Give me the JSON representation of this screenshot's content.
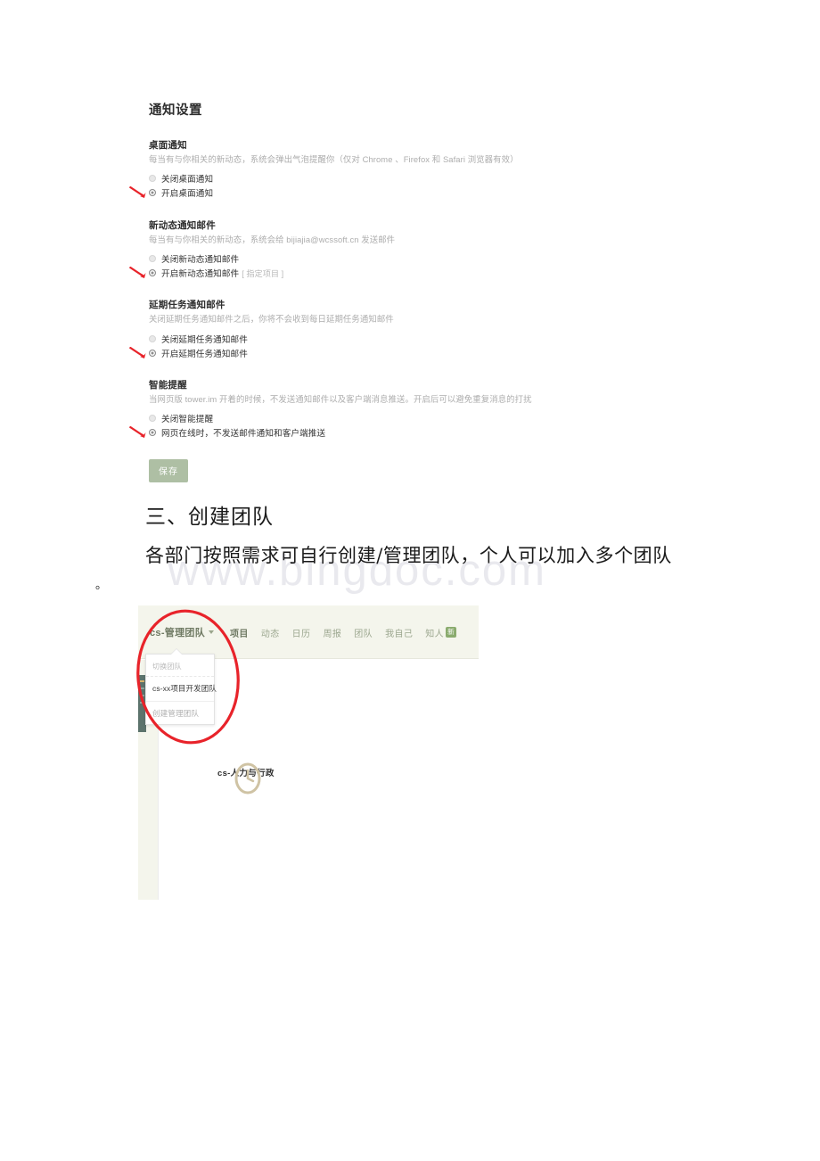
{
  "settings_panel": {
    "title": "通知设置",
    "blocks": [
      {
        "heading": "桌面通知",
        "description": "每当有与你相关的新动态，系统会弹出气泡提醒你（仅对 Chrome 、Firefox 和 Safari 浏览器有效）",
        "options": [
          {
            "label": "关闭桌面通知",
            "checked": false,
            "arrow": false,
            "sub": ""
          },
          {
            "label": "开启桌面通知",
            "checked": true,
            "arrow": true,
            "sub": ""
          }
        ]
      },
      {
        "heading": "新动态通知邮件",
        "description": "每当有与你相关的新动态，系统会给 bijiajia@wcssoft.cn 发送邮件",
        "options": [
          {
            "label": "关闭新动态通知邮件",
            "checked": false,
            "arrow": false,
            "sub": ""
          },
          {
            "label": "开启新动态通知邮件",
            "checked": true,
            "arrow": true,
            "sub": "[ 指定项目 ]"
          }
        ]
      },
      {
        "heading": "延期任务通知邮件",
        "description": "关闭延期任务通知邮件之后，你将不会收到每日延期任务通知邮件",
        "options": [
          {
            "label": "关闭延期任务通知邮件",
            "checked": false,
            "arrow": false,
            "sub": ""
          },
          {
            "label": "开启延期任务通知邮件",
            "checked": true,
            "arrow": true,
            "sub": ""
          }
        ]
      },
      {
        "heading": "智能提醒",
        "description": "当网页版 tower.im 开着的时候，不发送通知邮件以及客户端消息推送。开启后可以避免重复消息的打扰",
        "options": [
          {
            "label": "关闭智能提醒",
            "checked": false,
            "arrow": false,
            "sub": ""
          },
          {
            "label": "网页在线时，不发送邮件通知和客户端推送",
            "checked": true,
            "arrow": true,
            "sub": ""
          }
        ]
      }
    ],
    "save_label": "保存"
  },
  "document": {
    "heading": "三、创建团队",
    "paragraph": "各部门按照需求可自行创建/管理团队，个人可以加入多个团队",
    "paragraph_tail": "。",
    "watermark": "www.bingdoc.com"
  },
  "app": {
    "team_switcher": "cs-管理团队",
    "nav_items": [
      {
        "label": "项目",
        "active": true,
        "badge": ""
      },
      {
        "label": "动态",
        "active": false,
        "badge": ""
      },
      {
        "label": "日历",
        "active": false,
        "badge": ""
      },
      {
        "label": "周报",
        "active": false,
        "badge": ""
      },
      {
        "label": "团队",
        "active": false,
        "badge": ""
      },
      {
        "label": "我自己",
        "active": false,
        "badge": ""
      },
      {
        "label": "知人",
        "active": false,
        "badge": "新"
      }
    ],
    "dropdown": {
      "header": "切换团队",
      "items": [
        "cs-xx项目开发团队"
      ],
      "footer": "创建管理团队"
    },
    "project_label": "cs-人力与行政"
  },
  "colors": {
    "nav_background": "#f4f5ec",
    "nav_text": "#9ca78f",
    "nav_active": "#6f7a63",
    "badge_green": "#8aab6e",
    "save_button": "#aebfa4",
    "rail_dark": "#5c736c",
    "annotation_red": "#e8232a",
    "watermark_gray": "#e9e9ee"
  }
}
